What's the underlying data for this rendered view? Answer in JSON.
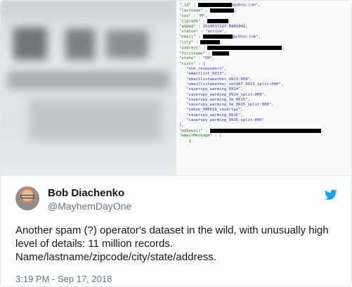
{
  "code": {
    "id_key": "\"_id\"",
    "id_suffix": "@yahoo.com\",",
    "lastname_key": "\"lastname\"",
    "sex_key": "\"sex\"",
    "sex_val": "\"M\",",
    "zipcode_key": "\"zipcode\"",
    "added_key": "\"added\"",
    "added_val": "1524537227.0401042,",
    "status_key": "\"status\"",
    "status_val": "\"active\",",
    "email_key": "\"email\"",
    "email_suffix": "@yahoo.com\",",
    "city_key": "\"city\"",
    "address_key": "\"address\"",
    "firstname_key": "\"firstname\"",
    "state_key": "\"state\"",
    "state_val": "\"OH\",",
    "lists_key": "\"lists\"",
    "lists_open": "[",
    "list_items": [
      "\"non_responders\",",
      "\"emaillist_0913\",",
      "\"emaillistweather_0913:000\",",
      "\"emaillistweather_set467_0913_split:000\",",
      "\"saverspy_warming_0914\",",
      "\"saverspy_warming_0914_split:000\",",
      "\"saverspy_warming_1m_0915\",",
      "\"saverspy_warming_1m_0915_split:000\",",
      "\"yahoo_090618_saverspy\",",
      "\"saverspy_warming_0916\",",
      "\"saverspy_warming_0916_split:000\""
    ],
    "lists_close": "],",
    "md5email_key": "\"md5email\"",
    "emailmessage_key": "\"emailMessage\"",
    "emailmessage_open": "[",
    "brace_open": "{"
  },
  "tweet": {
    "author_name": "Bob Diachenko",
    "author_handle": "@MayhemDayOne",
    "text": "Another spam (?) operator's dataset in the wild, with unusually high level of details: 11 million records. Name/lastname/zipcode/city/state/address.",
    "timestamp": "3:19 PM - Sep 17, 2018",
    "twitter_blue": "#1da1f2"
  }
}
